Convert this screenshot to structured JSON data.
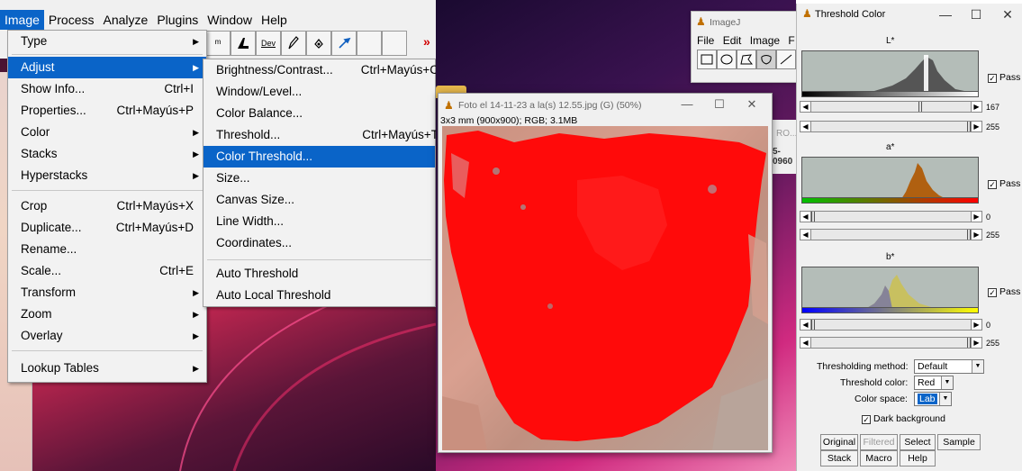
{
  "imagej_menubar": [
    "Image",
    "Process",
    "Analyze",
    "Plugins",
    "Window",
    "Help"
  ],
  "toolbar": {
    "dev_label": "Dev"
  },
  "image_menu": [
    {
      "label": "Type",
      "shortcut": "",
      "submenu": true
    },
    {
      "label": "Adjust",
      "shortcut": "",
      "submenu": true,
      "highlighted": true
    },
    {
      "label": "Show Info...",
      "shortcut": "Ctrl+I"
    },
    {
      "label": "Properties...",
      "shortcut": "Ctrl+Mayús+P"
    },
    {
      "label": "Color",
      "shortcut": "",
      "submenu": true
    },
    {
      "label": "Stacks",
      "shortcut": "",
      "submenu": true
    },
    {
      "label": "Hyperstacks",
      "shortcut": "",
      "submenu": true
    },
    {
      "label": "Crop",
      "shortcut": "Ctrl+Mayús+X"
    },
    {
      "label": "Duplicate...",
      "shortcut": "Ctrl+Mayús+D"
    },
    {
      "label": "Rename...",
      "shortcut": ""
    },
    {
      "label": "Scale...",
      "shortcut": "Ctrl+E"
    },
    {
      "label": "Transform",
      "shortcut": "",
      "submenu": true
    },
    {
      "label": "Zoom",
      "shortcut": "",
      "submenu": true
    },
    {
      "label": "Overlay",
      "shortcut": "",
      "submenu": true
    },
    {
      "label": "Lookup Tables",
      "shortcut": "",
      "submenu": true
    }
  ],
  "adjust_menu": [
    {
      "label": "Brightness/Contrast...",
      "shortcut": "Ctrl+Mayús+C"
    },
    {
      "label": "Window/Level...",
      "shortcut": ""
    },
    {
      "label": "Color Balance...",
      "shortcut": ""
    },
    {
      "label": "Threshold...",
      "shortcut": "Ctrl+Mayús+T"
    },
    {
      "label": "Color Threshold...",
      "shortcut": "",
      "highlighted": true
    },
    {
      "label": "Size...",
      "shortcut": ""
    },
    {
      "label": "Canvas Size...",
      "shortcut": ""
    },
    {
      "label": "Line Width...",
      "shortcut": ""
    },
    {
      "label": "Coordinates...",
      "shortcut": ""
    },
    {
      "label": "Auto Threshold",
      "shortcut": ""
    },
    {
      "label": "Auto Local Threshold",
      "shortcut": ""
    }
  ],
  "image_window": {
    "title": "Foto el 14-11-23 a la(s) 12.55.jpg (G) (50%)",
    "info": "3x3 mm (900x900); RGB; 3.1MB",
    "overlay_color": "#ff0000"
  },
  "imagej_window": {
    "title": "ImageJ",
    "menu": [
      "File",
      "Edit",
      "Image",
      "F"
    ]
  },
  "roi_strip": {
    "label": "RO...",
    "code": "5-0960"
  },
  "threshold_color": {
    "title": "Threshold Color",
    "channels": [
      {
        "label": "L*",
        "pass_label": "Pass",
        "pass_checked": true,
        "min": "167",
        "max": "255",
        "bar_colors": [
          "#000000",
          "#ffffff"
        ]
      },
      {
        "label": "a*",
        "pass_label": "Pass",
        "pass_checked": true,
        "min": "0",
        "max": "255",
        "bar_colors": [
          "#00c000",
          "#ff0000"
        ]
      },
      {
        "label": "b*",
        "pass_label": "Pass",
        "pass_checked": true,
        "min": "0",
        "max": "255",
        "bar_colors": [
          "#0000ff",
          "#ffff00"
        ]
      }
    ],
    "thresholding_method_label": "Thresholding method:",
    "thresholding_method": "Default",
    "threshold_color_label": "Threshold color:",
    "threshold_color": "Red",
    "color_space_label": "Color space:",
    "color_space": "Lab",
    "dark_background_label": "Dark background",
    "dark_background": true,
    "buttons_row1": [
      "Original",
      "Filtered",
      "Select",
      "Sample"
    ],
    "buttons_row2": [
      "Stack",
      "Macro",
      "Help"
    ]
  }
}
